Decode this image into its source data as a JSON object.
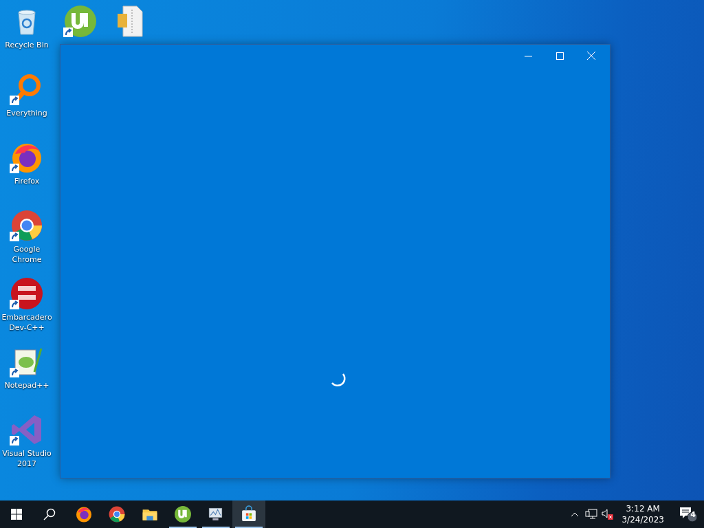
{
  "desktop_icons": [
    {
      "kind": "recycle",
      "label": "Recycle Bin",
      "shortcut": false
    },
    {
      "kind": "utorrent",
      "shortcut": true
    },
    {
      "kind": "archive",
      "shortcut": false
    },
    {
      "kind": "everything",
      "label": "Everything",
      "shortcut": true
    },
    {
      "kind": "firefox",
      "label": "Firefox",
      "shortcut": true
    },
    {
      "kind": "chrome",
      "label": "Google Chrome",
      "shortcut": true
    },
    {
      "kind": "devcpp",
      "label": "Embarcadero Dev-C++",
      "shortcut": true
    },
    {
      "kind": "notepad",
      "label": "Notepad++",
      "shortcut": true
    },
    {
      "kind": "vs",
      "label": "Visual Studio 2017",
      "shortcut": true
    }
  ],
  "window": {
    "loading": true
  },
  "taskbar": {
    "apps": [
      {
        "kind": "firefox",
        "running": false,
        "selected": false
      },
      {
        "kind": "chrome",
        "running": false,
        "selected": false
      },
      {
        "kind": "explorer",
        "running": false,
        "selected": false
      },
      {
        "kind": "utorrent",
        "running": true,
        "selected": false
      },
      {
        "kind": "monitor",
        "running": true,
        "selected": false
      },
      {
        "kind": "store",
        "running": true,
        "selected": true
      }
    ],
    "time": "3:12 AM",
    "date": "3/24/2023",
    "sound_muted": true,
    "notification_count": "4"
  }
}
